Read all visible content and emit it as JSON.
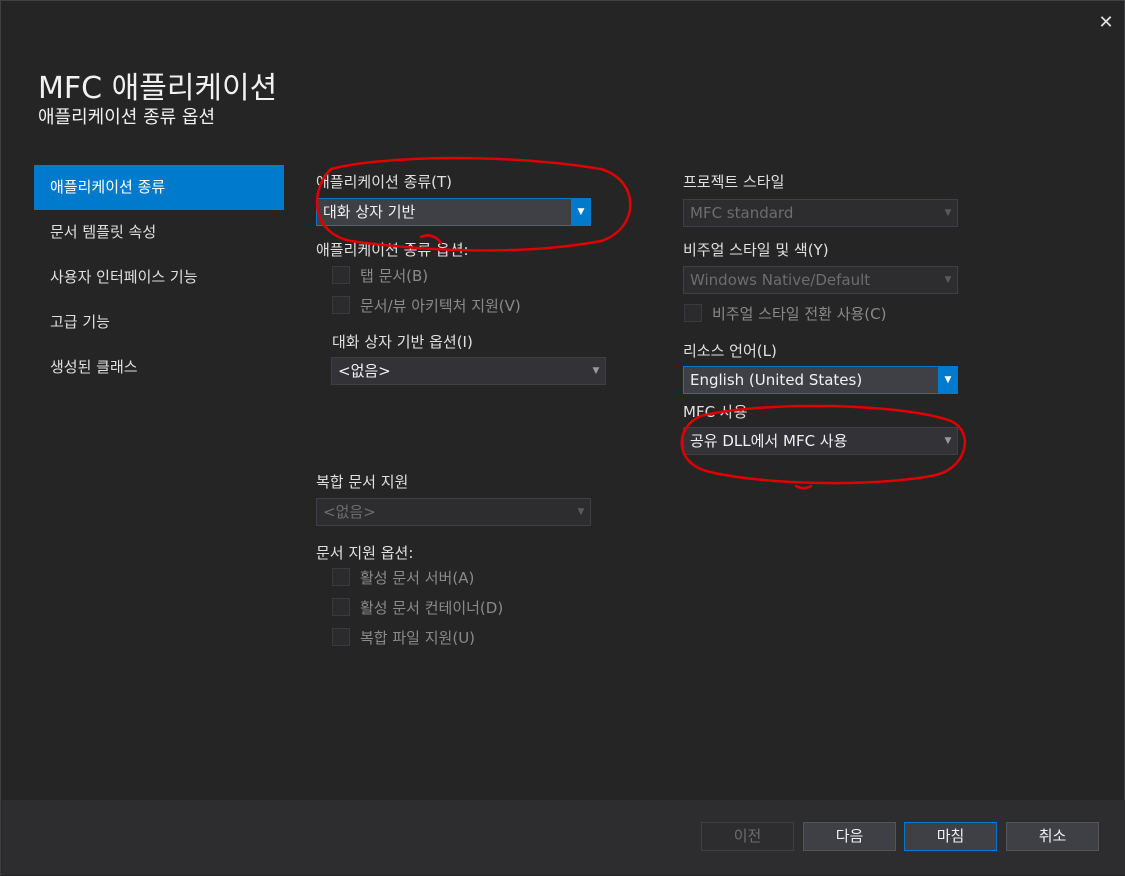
{
  "window": {
    "title": "MFC 애플리케이션",
    "subtitle": "애플리케이션 종류 옵션",
    "close_glyph": "✕"
  },
  "nav": {
    "items": [
      {
        "label": "애플리케이션 종류",
        "active": true
      },
      {
        "label": "문서 템플릿 속성"
      },
      {
        "label": "사용자 인터페이스 기능"
      },
      {
        "label": "고급 기능"
      },
      {
        "label": "생성된 클래스"
      }
    ]
  },
  "left_column": {
    "app_type_label": "애플리케이션 종류(T)",
    "app_type_value": "대화 상자 기반",
    "app_type_options_label": "애플리케이션 종류 옵션:",
    "checkboxes": [
      {
        "label": "탭 문서(B)",
        "checked": false,
        "enabled": false
      },
      {
        "label": "문서/뷰 아키텍처 지원(V)",
        "checked": false,
        "enabled": false
      }
    ],
    "dialog_options_label": "대화 상자 기반 옵션(I)",
    "dialog_options_value": "<없음>",
    "compound_label": "복합 문서 지원",
    "compound_value": "<없음>",
    "doc_support_label": "문서 지원 옵션:",
    "doc_support_checkboxes": [
      {
        "label": "활성 문서 서버(A)",
        "checked": false,
        "enabled": false
      },
      {
        "label": "활성 문서 컨테이너(D)",
        "checked": false,
        "enabled": false
      },
      {
        "label": "복합 파일 지원(U)",
        "checked": false,
        "enabled": false
      }
    ]
  },
  "right_column": {
    "project_style_label": "프로젝트 스타일",
    "project_style_value": "MFC standard",
    "visual_style_label": "비주얼 스타일 및 색(Y)",
    "visual_style_value": "Windows Native/Default",
    "visual_switch_label": "비주얼 스타일 전환 사용(C)",
    "resource_lang_label": "리소스 언어(L)",
    "resource_lang_value": "English (United States)",
    "mfc_use_label": "MFC 사용",
    "mfc_use_value": "공유 DLL에서 MFC 사용"
  },
  "footer": {
    "prev": "이전",
    "next": "다음",
    "finish": "마침",
    "cancel": "취소"
  },
  "colors": {
    "accent": "#007acc",
    "background": "#252526",
    "annotation": "#e00000"
  },
  "icons": {
    "dropdown": "chevron-down-icon",
    "close": "close-icon"
  }
}
